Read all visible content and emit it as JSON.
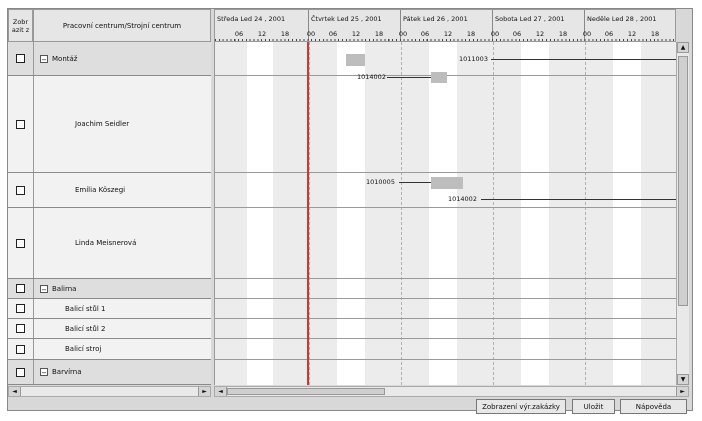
{
  "header": {
    "show_col": "Zobr\nazit z",
    "resource_col": "Pracovní centrum/Strojní centrum"
  },
  "days": [
    {
      "label": "Středa Led 24 , 2001",
      "hours": [
        "06",
        "12",
        "18"
      ]
    },
    {
      "label": "Čtvrtek Led 25 , 2001",
      "hours": [
        "00",
        "06",
        "12",
        "18"
      ]
    },
    {
      "label": "Pátek Led 26 , 2001",
      "hours": [
        "00",
        "06",
        "12",
        "18"
      ]
    },
    {
      "label": "Sobota Led 27 , 2001",
      "hours": [
        "00",
        "06",
        "12",
        "18"
      ]
    },
    {
      "label": "Neděle Led 28 , 2001",
      "hours": [
        "00",
        "06",
        "12",
        "18"
      ]
    }
  ],
  "rows": [
    {
      "label": "Montáž",
      "group": true,
      "toggle": "−"
    },
    {
      "label": "Joachim Seidler"
    },
    {
      "label": "Emília Köszegi"
    },
    {
      "label": "Linda Meisnerová"
    },
    {
      "label": "Balirna",
      "group": true,
      "toggle": "−"
    },
    {
      "label": "Balicí stůl 1"
    },
    {
      "label": "Balicí stůl 2"
    },
    {
      "label": "Balicí stroj"
    },
    {
      "label": "Barvírna",
      "group": true,
      "toggle": "−"
    }
  ],
  "tasks": {
    "t1": "1011003",
    "t2": "1014002",
    "t3": "1010005",
    "t4": "1014002"
  },
  "scroll": {
    "up": "▲",
    "down": "▼",
    "left": "◄",
    "right": "►"
  },
  "buttons": {
    "display_orders": "Zobrazení výr.zakázky",
    "save": "Uložit",
    "help": "Nápověda"
  },
  "colors": {
    "current_time_line": "#d9342b",
    "task_block": "#bdbdbd"
  }
}
